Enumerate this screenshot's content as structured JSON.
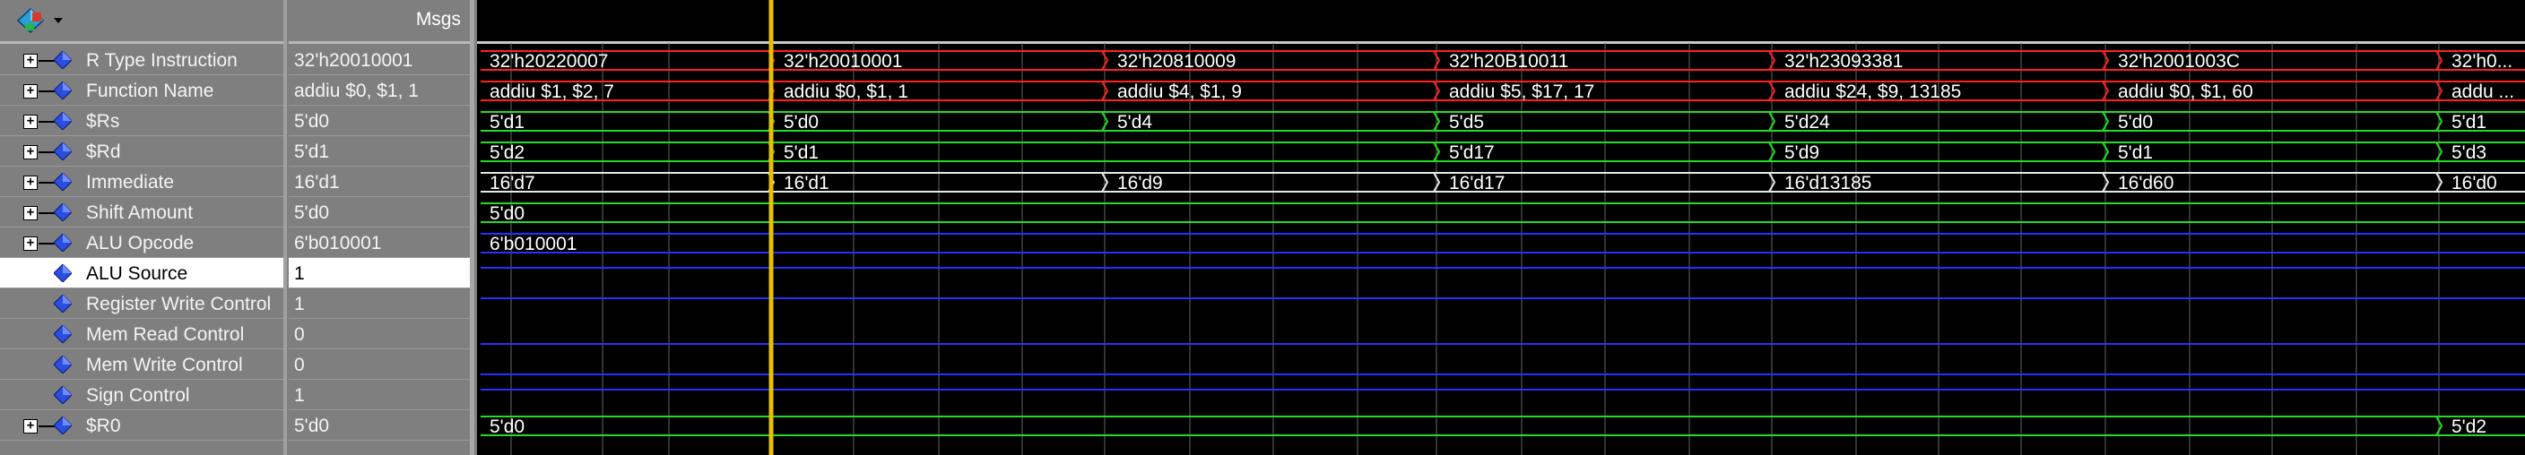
{
  "msgs_header": "Msgs",
  "signals": [
    {
      "name": "R Type Instruction",
      "value": "32'h20010001",
      "expandable": true,
      "bus": true,
      "color": "#ff2020"
    },
    {
      "name": "Function Name",
      "value": "addiu $0, $1, 1",
      "expandable": true,
      "bus": true,
      "color": "#ff2020"
    },
    {
      "name": "$Rs",
      "value": "5'd0",
      "expandable": true,
      "bus": true,
      "color": "#22dd22"
    },
    {
      "name": "$Rd",
      "value": "5'd1",
      "expandable": true,
      "bus": true,
      "color": "#22dd22"
    },
    {
      "name": "Immediate",
      "value": "16'd1",
      "expandable": true,
      "bus": true,
      "color": "#e8e8e8"
    },
    {
      "name": "Shift Amount",
      "value": "5'd0",
      "expandable": true,
      "bus": true,
      "color": "#22dd22"
    },
    {
      "name": "ALU Opcode",
      "value": "6'b010001",
      "expandable": true,
      "bus": true,
      "color": "#2233ff"
    },
    {
      "name": "ALU Source",
      "value": "1",
      "expandable": false,
      "bus": false,
      "color": "#2233ff",
      "selected": true
    },
    {
      "name": "Register Write Control",
      "value": "1",
      "expandable": false,
      "bus": false,
      "color": "#2233ff"
    },
    {
      "name": "Mem Read Control",
      "value": "0",
      "expandable": false,
      "bus": false,
      "color": "#2233ff"
    },
    {
      "name": "Mem Write Control",
      "value": "0",
      "expandable": false,
      "bus": false,
      "color": "#2233ff"
    },
    {
      "name": "Sign Control",
      "value": "1",
      "expandable": false,
      "bus": false,
      "color": "#2233ff"
    },
    {
      "name": "$R0",
      "value": "5'd0",
      "expandable": true,
      "bus": true,
      "color": "#22dd22"
    }
  ],
  "bus_segments": [
    [
      "32'h20220007",
      "32'h20010001",
      "32'h20810009",
      "32'h20B10011",
      "32'h23093381",
      "32'h2001003C",
      "32'h0..."
    ],
    [
      "addiu $1, $2, 7",
      "addiu $0, $1, 1",
      "addiu $4, $1, 9",
      "addiu $5, $17, 17",
      "addiu $24, $9, 13185",
      "addiu $0, $1, 60",
      "addu ..."
    ],
    [
      "5'd1",
      "5'd0",
      "5'd4",
      "5'd5",
      "5'd24",
      "5'd0",
      "5'd1"
    ],
    [
      "5'd2",
      "5'd1",
      "",
      "5'd17",
      "5'd9",
      "5'd1",
      "5'd3"
    ],
    [
      "16'd7",
      "16'd1",
      "16'd9",
      "16'd17",
      "16'd13185",
      "16'd60",
      "16'd0"
    ],
    [
      "5'd0",
      "",
      "",
      "",
      "",
      "",
      ""
    ],
    [
      "6'b010001",
      "",
      "",
      "",
      "",
      "",
      ""
    ],
    [],
    [],
    [],
    [],
    [],
    [
      "5'd0",
      "",
      "",
      "",
      "",
      "",
      "5'd2"
    ]
  ],
  "icons": {
    "wave_tool": "waveform-diamond-icon",
    "dropdown": "chevron-down-icon",
    "expander": "plus-icon",
    "signal": "signal-diamond-icon"
  },
  "colors": {
    "cursor": "#e8c000",
    "grid": "#666666",
    "header_bg": "#7f7f7f"
  }
}
